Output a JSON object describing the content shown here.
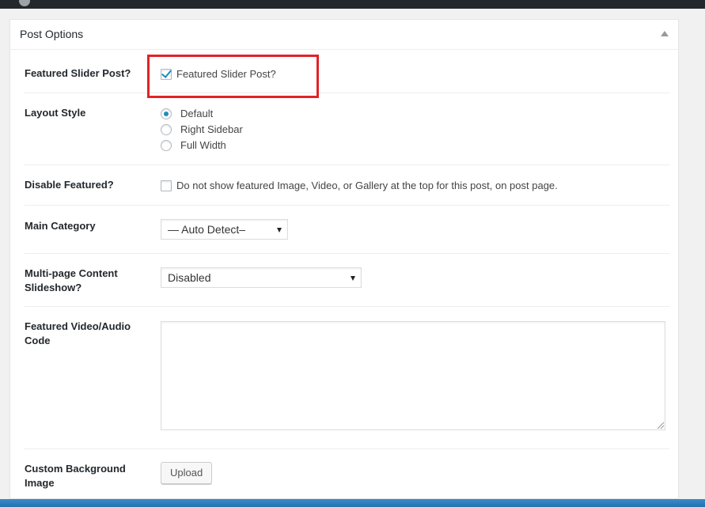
{
  "postbox": {
    "title": "Post Options"
  },
  "featured_slider": {
    "label": "Featured Slider Post?",
    "checkbox_label": "Featured Slider Post?",
    "checked": true
  },
  "layout_style": {
    "label": "Layout Style",
    "options": [
      "Default",
      "Right Sidebar",
      "Full Width"
    ],
    "selected": "Default"
  },
  "disable_featured": {
    "label": "Disable Featured?",
    "checkbox_label": "Do not show featured Image, Video, or Gallery at the top for this post, on post page.",
    "checked": false
  },
  "main_category": {
    "label": "Main Category",
    "selected": "— Auto Detect–"
  },
  "multipage": {
    "label": "Multi-page Content Slideshow?",
    "selected": "Disabled"
  },
  "featured_video": {
    "label": "Featured Video/Audio Code",
    "value": ""
  },
  "custom_background": {
    "label": "Custom Background Image",
    "button_label": "Upload"
  },
  "colors": {
    "highlight": "#e32227",
    "accent": "#1e8cbe",
    "admin_bar": "#23282d"
  },
  "icons": {
    "toggle": "triangle-up-icon",
    "select_arrow": "caret-down-icon"
  }
}
